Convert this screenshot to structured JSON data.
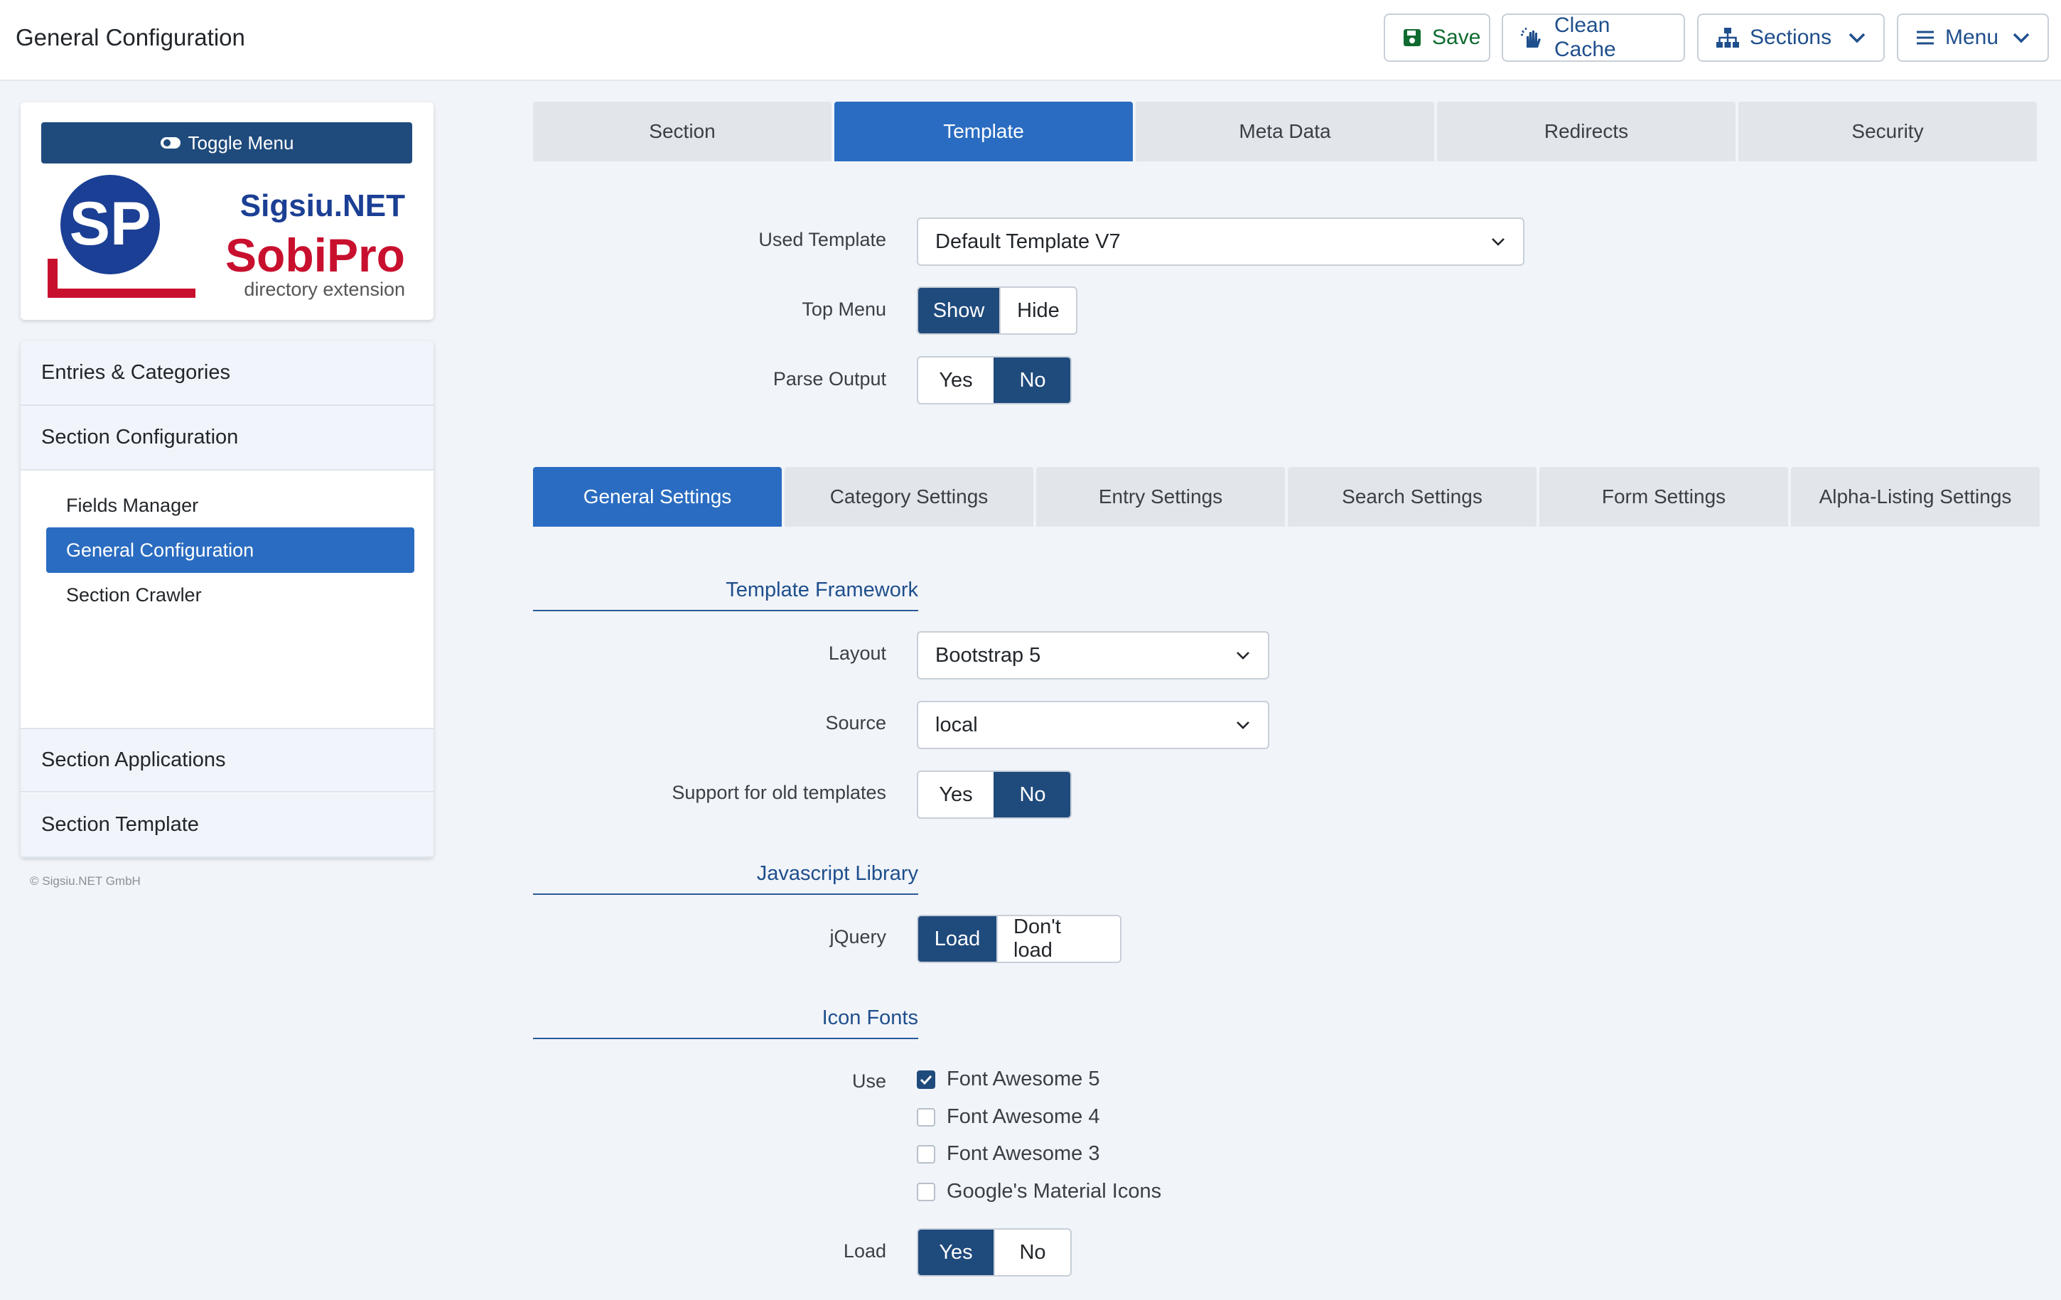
{
  "header": {
    "title": "General Configuration",
    "save_label": "Save",
    "clean_cache_label": "Clean Cache",
    "sections_label": "Sections",
    "menu_label": "Menu"
  },
  "sidebar": {
    "toggle_label": "Toggle Menu",
    "logo": {
      "brand": "Sigsiu.NET",
      "product": "SobiPro",
      "tagline": "directory extension"
    },
    "groups": [
      {
        "label": "Entries & Categories"
      },
      {
        "label": "Section Configuration"
      },
      {
        "label": "Section Applications"
      },
      {
        "label": "Section Template"
      }
    ],
    "sub_items": [
      {
        "label": "Fields Manager"
      },
      {
        "label": "General Configuration",
        "active": true
      },
      {
        "label": "Section Crawler"
      }
    ],
    "copyright": "© Sigsiu.NET GmbH"
  },
  "tabs": [
    "Section",
    "Template",
    "Meta Data",
    "Redirects",
    "Security"
  ],
  "active_tab": "Template",
  "template": {
    "used_template_label": "Used Template",
    "used_template_value": "Default Template V7",
    "top_menu_label": "Top Menu",
    "top_menu_options": [
      "Show",
      "Hide"
    ],
    "top_menu_value": "Show",
    "parse_output_label": "Parse Output",
    "parse_output_options": [
      "Yes",
      "No"
    ],
    "parse_output_value": "No"
  },
  "subtabs": [
    "General Settings",
    "Category Settings",
    "Entry Settings",
    "Search Settings",
    "Form Settings",
    "Alpha-Listing Settings"
  ],
  "active_subtab": "General Settings",
  "framework": {
    "heading": "Template Framework",
    "layout_label": "Layout",
    "layout_value": "Bootstrap 5",
    "source_label": "Source",
    "source_value": "local",
    "old_templates_label": "Support for old templates",
    "old_templates_options": [
      "Yes",
      "No"
    ],
    "old_templates_value": "No"
  },
  "js": {
    "heading": "Javascript Library",
    "jquery_label": "jQuery",
    "jquery_options": [
      "Load",
      "Don't load"
    ],
    "jquery_value": "Load"
  },
  "icons": {
    "heading": "Icon Fonts",
    "use_label": "Use",
    "fonts": [
      {
        "label": "Font Awesome 5",
        "checked": true
      },
      {
        "label": "Font Awesome 4",
        "checked": false
      },
      {
        "label": "Font Awesome 3",
        "checked": false
      },
      {
        "label": "Google's Material Icons",
        "checked": false
      }
    ],
    "load_label": "Load",
    "load_options": [
      "Yes",
      "No"
    ],
    "load_value": "Yes"
  },
  "colors": {
    "primary": "#2a6cc1",
    "dark": "#1f4a7c",
    "save": "#0f6b2f",
    "logo_blue": "#1b3f94",
    "logo_red": "#c8102e"
  }
}
